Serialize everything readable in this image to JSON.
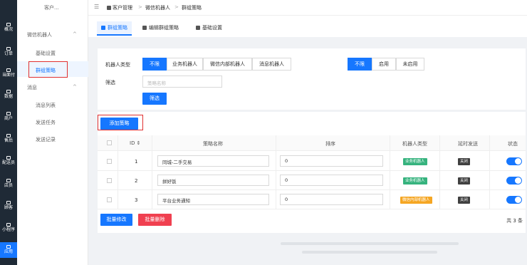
{
  "leftnav": {
    "items": [
      {
        "label": "概况",
        "icon": "overview-icon"
      },
      {
        "label": "订单",
        "icon": "order-icon"
      },
      {
        "label": "当面付",
        "icon": "face-pay-icon"
      },
      {
        "label": "数据",
        "icon": "data-icon"
      },
      {
        "label": "商户",
        "icon": "merchant-icon"
      },
      {
        "label": "售后",
        "icon": "aftersale-icon"
      },
      {
        "label": "配送员",
        "icon": "courier-icon"
      },
      {
        "label": "店员",
        "icon": "clerk-icon"
      },
      {
        "label": "顾客",
        "icon": "customer-icon"
      },
      {
        "label": "小程序",
        "icon": "miniprogram-icon"
      },
      {
        "label": "应用",
        "icon": "apps-icon"
      }
    ],
    "active": "应用"
  },
  "subnav": {
    "top_label": "客户...",
    "group1": "微信机器人",
    "group1_items": [
      "基础设置",
      "群组策略"
    ],
    "group2": "消息",
    "group2_items": [
      "消息列表",
      "发送任务",
      "发送记录"
    ],
    "caret": "^"
  },
  "breadcrumb": {
    "items": [
      "客户管理",
      "微信机器人",
      "群组策略"
    ],
    "sep": ">",
    "menu_glyph": "☰"
  },
  "tabs": [
    "群组策略",
    "编辑群组策略",
    "基础设置"
  ],
  "filter": {
    "type_label": "机器人类型",
    "type_options": [
      "不限",
      "业务机器人",
      "微信内部机器人",
      "消息机器人"
    ],
    "type_selected": "不限",
    "delay_options": [
      "不限",
      "启用",
      "未启用"
    ],
    "delay_selected": "不限",
    "filter_label": "筛选",
    "search_placeholder": "策略名称",
    "filter_button": "筛选"
  },
  "list": {
    "add_button": "添加策略",
    "headers": {
      "id": "ID ⇕",
      "name": "策略名称",
      "sort": "排序",
      "type": "机器人类型",
      "delay": "延时发送",
      "status": "状态"
    },
    "rows": [
      {
        "id": "1",
        "name": "同城-二手交易",
        "sort": "0",
        "type": "业务机器人",
        "type_color": "green",
        "delay": "关闭",
        "status": "on"
      },
      {
        "id": "2",
        "name": "拼好饭",
        "sort": "0",
        "type": "业务机器人",
        "type_color": "green",
        "delay": "关闭",
        "status": "on"
      },
      {
        "id": "3",
        "name": "平台业务通知",
        "sort": "0",
        "type": "微信内部机器人",
        "type_color": "orange",
        "delay": "关闭",
        "status": "on"
      }
    ],
    "batch_edit": "批量修改",
    "batch_delete": "批量删除",
    "total": "共 3 条"
  },
  "colors": {
    "primary": "#1677ff",
    "danger": "#f04050",
    "nav_bg": "#1f2a36",
    "tag_green": "#36b37e",
    "tag_orange": "#f5a623"
  }
}
